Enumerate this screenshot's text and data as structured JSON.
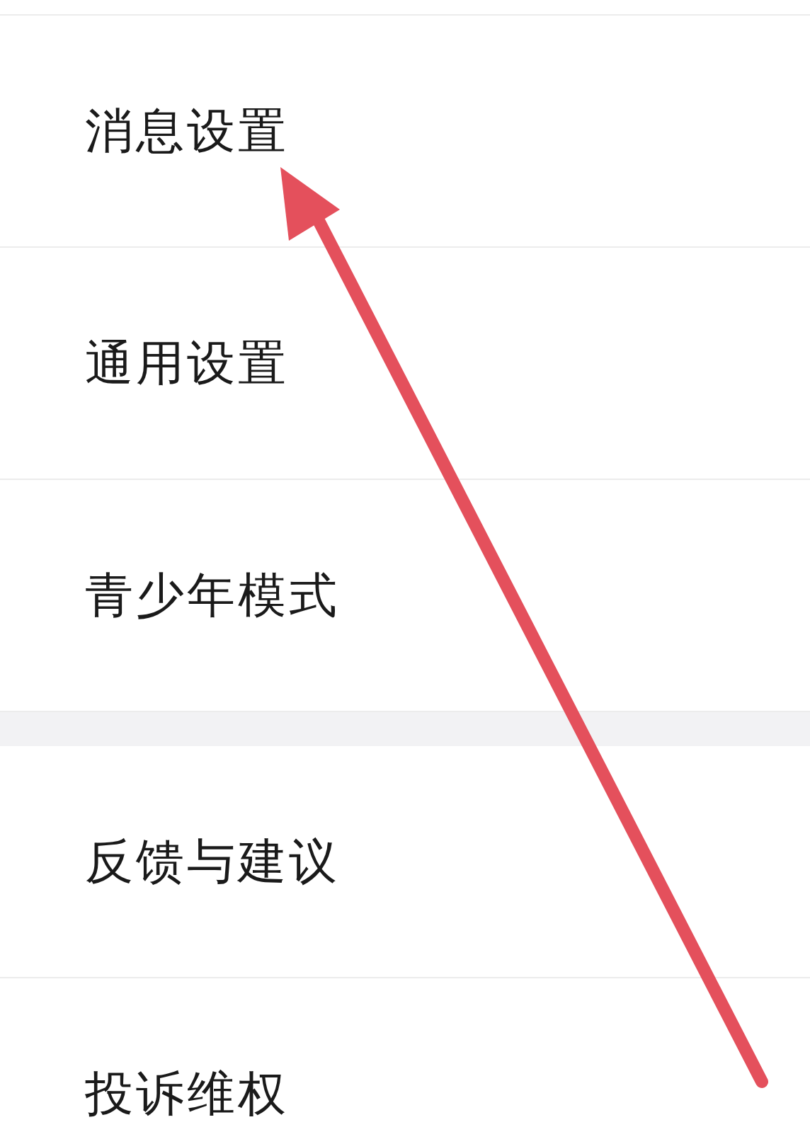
{
  "sections": [
    {
      "items": [
        {
          "label": "消息设置"
        },
        {
          "label": "通用设置"
        },
        {
          "label": "青少年模式"
        }
      ]
    },
    {
      "items": [
        {
          "label": "反馈与建议"
        },
        {
          "label": "投诉维权"
        }
      ]
    }
  ]
}
